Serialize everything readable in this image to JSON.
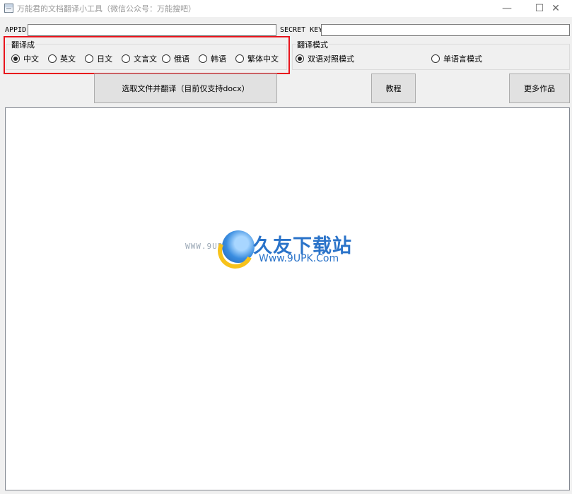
{
  "window": {
    "title": "万能君的文档翻译小工具（微信公众号：万能搜吧）",
    "minimize_glyph": "—",
    "maximize_glyph": "☐",
    "close_glyph": "✕"
  },
  "credentials": {
    "appid_label": "APPID",
    "appid_value": "",
    "secret_label": "SECRET KEY",
    "secret_value": ""
  },
  "translate_to": {
    "title": "翻译成",
    "selected": "中文",
    "options": [
      "中文",
      "英文",
      "日文",
      "文言文",
      "俄语",
      "韩语",
      "繁体中文"
    ]
  },
  "translate_mode": {
    "title": "翻译模式",
    "selected": "双语对照模式",
    "options": [
      "双语对照模式",
      "单语言模式"
    ]
  },
  "buttons": {
    "select_file": "选取文件并翻译（目前仅支持docx）",
    "tutorial": "教程",
    "more_works": "更多作品"
  },
  "output": {
    "text": ""
  },
  "watermark": {
    "site_small": "WWW.9UPK.COM",
    "brand": "久友下载站",
    "url": "Www.9UPK.Com"
  },
  "colors": {
    "highlight_border": "#e8141c",
    "window_bg": "#f0f0f0",
    "button_bg": "#e1e1e1"
  }
}
